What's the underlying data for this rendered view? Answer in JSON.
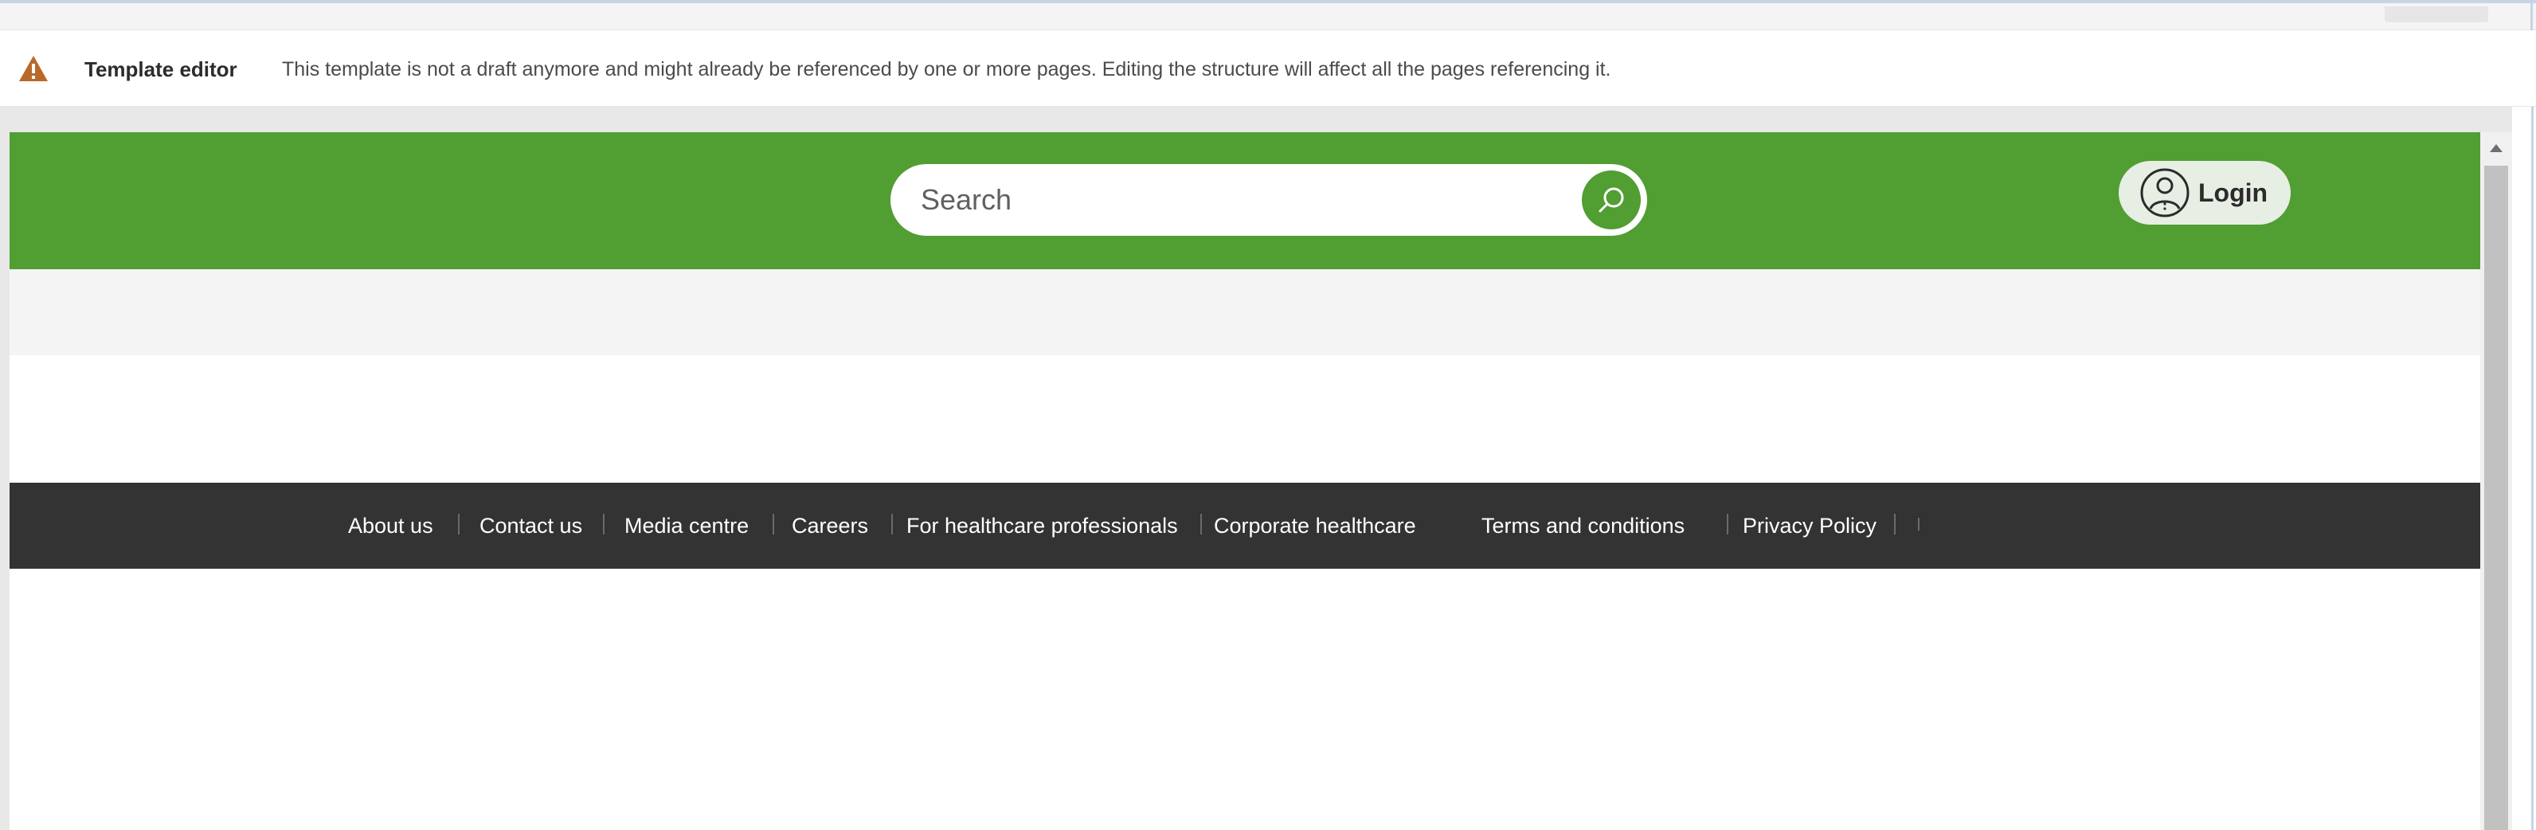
{
  "alert": {
    "title": "Template editor",
    "message": "This template is not a draft anymore and might already be referenced by one or more pages. Editing the structure will affect all the pages referencing it.",
    "icon": "warning-triangle-icon",
    "icon_color": "#b8692a"
  },
  "header": {
    "background_color": "#519e33",
    "search": {
      "placeholder": "Search",
      "icon": "search-icon"
    },
    "login": {
      "label": "Login",
      "icon": "user-circle-icon"
    }
  },
  "footer": {
    "background_color": "#333333",
    "links": [
      "About us",
      "Contact us",
      "Media centre",
      "Careers",
      "For healthcare professionals",
      "Corporate healthcare",
      "Terms and conditions",
      "Privacy Policy"
    ]
  },
  "scrollbar": {
    "up_icon": "scroll-up-arrow-icon"
  }
}
